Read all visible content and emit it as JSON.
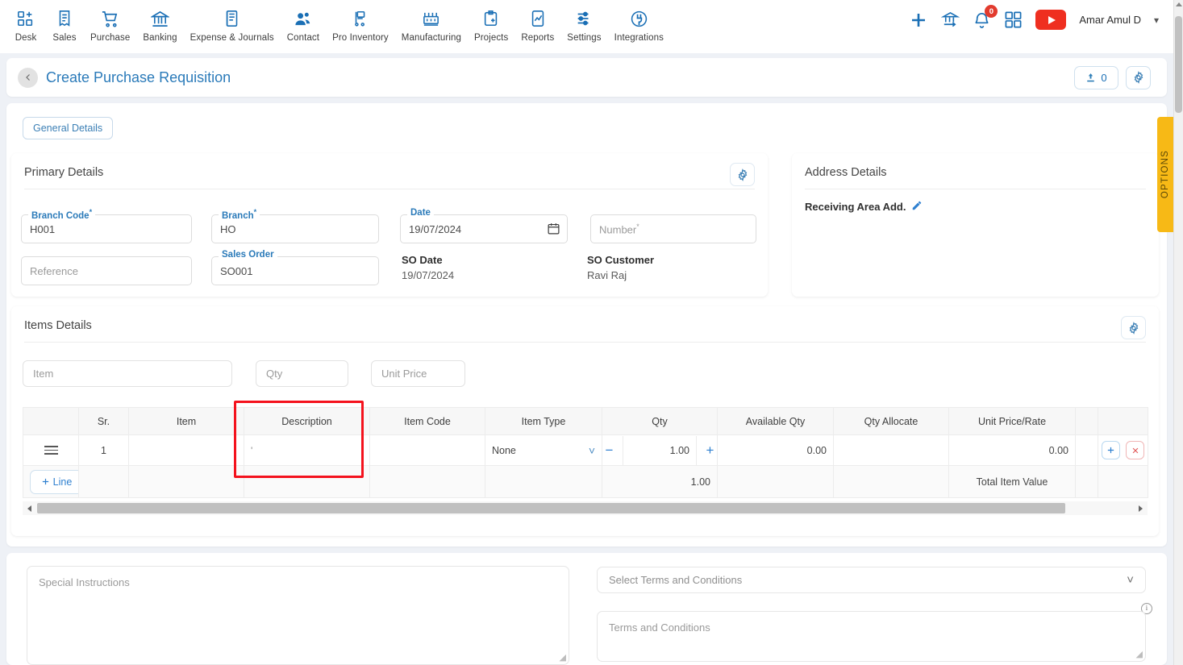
{
  "nav": {
    "items": [
      {
        "label": "Desk",
        "icon": "desk-grid-plus-icon"
      },
      {
        "label": "Sales",
        "icon": "sales-receipt-icon"
      },
      {
        "label": "Purchase",
        "icon": "purchase-cart-icon"
      },
      {
        "label": "Banking",
        "icon": "banking-bank-icon"
      },
      {
        "label": "Expense & Journals",
        "icon": "expense-journal-icon"
      },
      {
        "label": "Contact",
        "icon": "contact-people-icon"
      },
      {
        "label": "Pro Inventory",
        "icon": "pro-inventory-icon"
      },
      {
        "label": "Manufacturing",
        "icon": "manufacturing-factory-icon"
      },
      {
        "label": "Projects",
        "icon": "projects-clipboard-icon"
      },
      {
        "label": "Reports",
        "icon": "reports-chart-icon"
      },
      {
        "label": "Settings",
        "icon": "settings-sliders-icon"
      },
      {
        "label": "Integrations",
        "icon": "integrations-plug-icon"
      }
    ],
    "right": {
      "add_icon": "plus-icon",
      "bank_icon": "bank-transfer-icon",
      "notification_icon": "bell-icon",
      "notification_count": "0",
      "apps_icon": "apps-grid-icon",
      "youtube_icon": "youtube-icon",
      "user_name": "Amar Amul D",
      "user_caret_icon": "chevron-down-icon"
    }
  },
  "titlebar": {
    "back_icon": "chevron-left-icon",
    "title": "Create Purchase Requisition",
    "attach_icon": "upload-icon",
    "attach_count": "0",
    "settings_icon": "gear-icon"
  },
  "tabs": {
    "general_details": "General Details"
  },
  "primary_details": {
    "heading": "Primary Details",
    "gear_icon": "gear-icon",
    "fields": {
      "branch_code": {
        "label": "Branch Code",
        "required": true,
        "value": "H001"
      },
      "branch": {
        "label": "Branch",
        "required": true,
        "value": "HO"
      },
      "date": {
        "label": "Date",
        "required": false,
        "value": "19/07/2024",
        "icon": "calendar-icon"
      },
      "number": {
        "label": "",
        "required": true,
        "value": "",
        "placeholder": "Number"
      },
      "reference": {
        "label": "",
        "required": false,
        "value": "",
        "placeholder": "Reference"
      },
      "sales_order": {
        "label": "Sales Order",
        "required": false,
        "value": "SO001"
      }
    },
    "readonly": {
      "so_date": {
        "label": "SO Date",
        "value": "19/07/2024"
      },
      "so_customer": {
        "label": "SO Customer",
        "value": "Ravi Raj"
      }
    }
  },
  "address_details": {
    "heading": "Address Details",
    "receiving_area_label": "Receiving Area Add.",
    "edit_icon": "pencil-icon"
  },
  "options_tab": {
    "label": "OPTIONS",
    "color": "#f7b916"
  },
  "items_details": {
    "heading": "Items Details",
    "gear_icon": "gear-icon",
    "search_inputs": {
      "item_placeholder": "Item",
      "qty_placeholder": "Qty",
      "unit_price_placeholder": "Unit Price"
    },
    "columns": [
      "",
      "Sr.",
      "Item",
      "Description",
      "Item Code",
      "Item Type",
      "Qty",
      "Available Qty",
      "Qty Allocate",
      "Unit Price/Rate",
      "",
      ""
    ],
    "rows": [
      {
        "drag_icon": "hamburger-icon",
        "sr": "1",
        "item": "",
        "description": "'",
        "item_code": "",
        "item_type": "None",
        "item_type_caret": "chevron-down-icon",
        "qty_minus": "−",
        "qty": "1.00",
        "qty_plus": "+",
        "available_qty": "0.00",
        "qty_allocate": "",
        "unit_price_rate": "0.00",
        "add_icon": "plus-icon",
        "delete_icon": "close-x-icon"
      }
    ],
    "totals": {
      "qty_total": "1.00",
      "total_item_value_label": "Total Item Value"
    },
    "add_line": {
      "label": "Line",
      "icon": "plus-icon"
    },
    "scroll_left_icon": "caret-left-icon",
    "scroll_right_icon": "caret-right-icon",
    "highlight_color": "#f4121d",
    "highlighted_column": "Description"
  },
  "footer": {
    "special_instructions_placeholder": "Special Instructions",
    "select_terms_placeholder": "Select Terms and Conditions",
    "select_terms_caret": "chevron-down-icon",
    "terms_placeholder": "Terms and Conditions",
    "info_icon": "info-icon"
  }
}
